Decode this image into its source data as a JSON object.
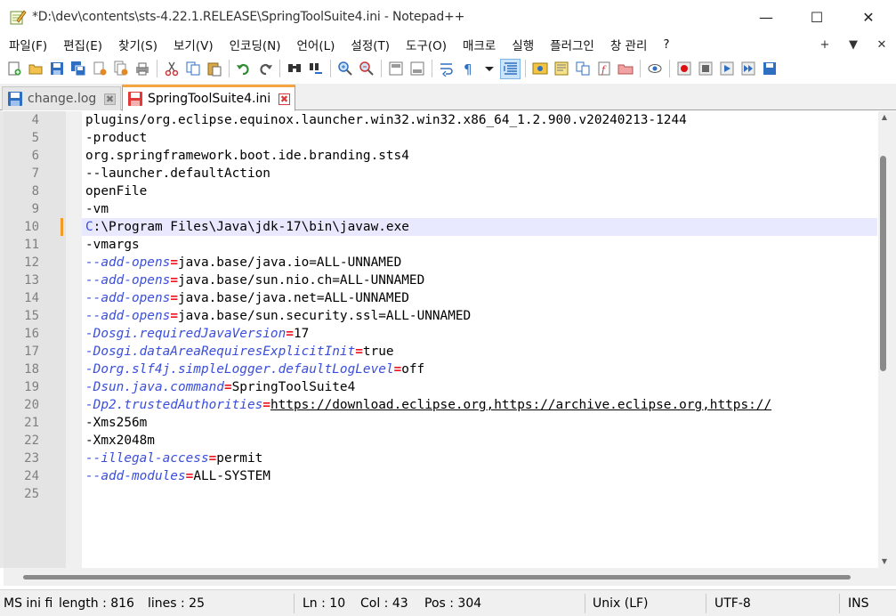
{
  "window": {
    "title": "*D:\\dev\\contents\\sts-4.22.1.RELEASE\\SpringToolSuite4.ini - Notepad++",
    "minimize": "—",
    "maximize": "☐",
    "close": "✕"
  },
  "menu": {
    "items": [
      "파일(F)",
      "편집(E)",
      "찾기(S)",
      "보기(V)",
      "인코딩(N)",
      "언어(L)",
      "설정(T)",
      "도구(O)",
      "매크로",
      "실행",
      "플러그인",
      "창 관리",
      "?"
    ],
    "right": [
      "+",
      "▼",
      "✕"
    ]
  },
  "tabs": [
    {
      "label": "change.log",
      "close": "✖"
    },
    {
      "label": "SpringToolSuite4.ini",
      "close": "✖"
    }
  ],
  "editor": {
    "current_line": 10,
    "lines": [
      {
        "n": "4",
        "parts": [
          {
            "t": "plugins/org.eclipse.equinox.launcher.win32.win32.x86_64_1.2.900.v20240213-1244",
            "c": "plain"
          }
        ]
      },
      {
        "n": "5",
        "parts": [
          {
            "t": "-product",
            "c": "plain"
          }
        ]
      },
      {
        "n": "6",
        "parts": [
          {
            "t": "org.springframework.boot.ide.branding.sts4",
            "c": "plain"
          }
        ]
      },
      {
        "n": "7",
        "parts": [
          {
            "t": "--launcher.defaultAction",
            "c": "plain"
          }
        ]
      },
      {
        "n": "8",
        "parts": [
          {
            "t": "openFile",
            "c": "plain"
          }
        ]
      },
      {
        "n": "9",
        "parts": [
          {
            "t": "-vm",
            "c": "plain"
          }
        ]
      },
      {
        "n": "10",
        "parts": [
          {
            "t": "C",
            "c": "cdrive"
          },
          {
            "t": ":\\Program Files\\Java\\jdk-17\\bin\\javaw.exe",
            "c": "plain"
          }
        ]
      },
      {
        "n": "11",
        "parts": [
          {
            "t": "-vmargs",
            "c": "plain"
          }
        ]
      },
      {
        "n": "12",
        "parts": [
          {
            "t": "--add-opens",
            "c": "key"
          },
          {
            "t": "=",
            "c": "eq"
          },
          {
            "t": "java.base/java.io=ALL-UNNAMED",
            "c": "val"
          }
        ]
      },
      {
        "n": "13",
        "parts": [
          {
            "t": "--add-opens",
            "c": "key"
          },
          {
            "t": "=",
            "c": "eq"
          },
          {
            "t": "java.base/sun.nio.ch=ALL-UNNAMED",
            "c": "val"
          }
        ]
      },
      {
        "n": "14",
        "parts": [
          {
            "t": "--add-opens",
            "c": "key"
          },
          {
            "t": "=",
            "c": "eq"
          },
          {
            "t": "java.base/java.net=ALL-UNNAMED",
            "c": "val"
          }
        ]
      },
      {
        "n": "15",
        "parts": [
          {
            "t": "--add-opens",
            "c": "key"
          },
          {
            "t": "=",
            "c": "eq"
          },
          {
            "t": "java.base/sun.security.ssl=ALL-UNNAMED",
            "c": "val"
          }
        ]
      },
      {
        "n": "16",
        "parts": [
          {
            "t": "-Dosgi.requiredJavaVersion",
            "c": "key"
          },
          {
            "t": "=",
            "c": "eq"
          },
          {
            "t": "17",
            "c": "val"
          }
        ]
      },
      {
        "n": "17",
        "parts": [
          {
            "t": "-Dosgi.dataAreaRequiresExplicitInit",
            "c": "key"
          },
          {
            "t": "=",
            "c": "eq"
          },
          {
            "t": "true",
            "c": "val"
          }
        ]
      },
      {
        "n": "18",
        "parts": [
          {
            "t": "-Dorg.slf4j.simpleLogger.defaultLogLevel",
            "c": "key"
          },
          {
            "t": "=",
            "c": "eq"
          },
          {
            "t": "off",
            "c": "val"
          }
        ]
      },
      {
        "n": "19",
        "parts": [
          {
            "t": "-Dsun.java.command",
            "c": "key"
          },
          {
            "t": "=",
            "c": "eq"
          },
          {
            "t": "SpringToolSuite4",
            "c": "val"
          }
        ]
      },
      {
        "n": "20",
        "parts": [
          {
            "t": "-Dp2.trustedAuthorities",
            "c": "key"
          },
          {
            "t": "=",
            "c": "eq"
          },
          {
            "t": "https://download.eclipse.org,https://archive.eclipse.org,https://",
            "c": "url"
          }
        ]
      },
      {
        "n": "21",
        "parts": [
          {
            "t": "-Xms256m",
            "c": "plain"
          }
        ]
      },
      {
        "n": "22",
        "parts": [
          {
            "t": "-Xmx2048m",
            "c": "plain"
          }
        ]
      },
      {
        "n": "23",
        "parts": [
          {
            "t": "--illegal-access",
            "c": "key"
          },
          {
            "t": "=",
            "c": "eq"
          },
          {
            "t": "permit",
            "c": "val"
          }
        ]
      },
      {
        "n": "24",
        "parts": [
          {
            "t": "--add-modules",
            "c": "key"
          },
          {
            "t": "=",
            "c": "eq"
          },
          {
            "t": "ALL-SYSTEM",
            "c": "val"
          }
        ]
      },
      {
        "n": "25",
        "parts": []
      }
    ]
  },
  "status": {
    "type": "MS ini fi",
    "length": "length : 816",
    "lines": "lines : 25",
    "ln": "Ln : 10",
    "col": "Col : 43",
    "pos": "Pos : 304",
    "eol": "Unix (LF)",
    "encoding": "UTF-8",
    "mode": "INS"
  },
  "colors": {
    "key": "#3a4edb",
    "operator": "#e8161e",
    "current_line": "#e8e8ff",
    "change_marker": "#f59a23",
    "active_tab_accent": "#f5a442"
  },
  "toolbar_icons": [
    "new-file-icon",
    "open-file-icon",
    "save-icon",
    "save-all-icon",
    "close-icon",
    "close-all-icon",
    "print-icon",
    "cut-icon",
    "copy-icon",
    "paste-icon",
    "undo-icon",
    "redo-icon",
    "find-icon",
    "replace-icon",
    "zoom-in-icon",
    "zoom-out-icon",
    "sync-vertical-icon",
    "sync-horizontal-icon",
    "word-wrap-icon",
    "show-all-chars-icon",
    "indent-guide-icon",
    "indent-guide-active-icon",
    "lang-udl-icon",
    "document-map-icon",
    "function-list-icon",
    "clipboard-history-icon",
    "folder-workspace-icon",
    "monitoring-icon",
    "record-macro-icon",
    "stop-record-icon",
    "play-macro-icon",
    "run-macro-multiple-icon",
    "save-macro-icon"
  ]
}
